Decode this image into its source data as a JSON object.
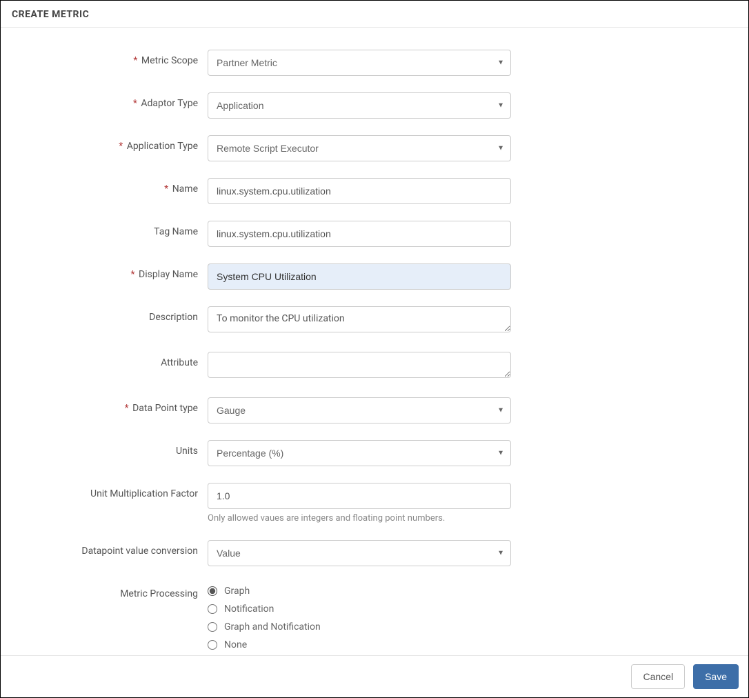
{
  "header": {
    "title": "CREATE METRIC"
  },
  "form": {
    "metric_scope": {
      "label": "Metric Scope",
      "required": true,
      "value": "Partner Metric"
    },
    "adaptor_type": {
      "label": "Adaptor Type",
      "required": true,
      "value": "Application"
    },
    "application_type": {
      "label": "Application Type",
      "required": true,
      "value": "Remote Script Executor"
    },
    "name": {
      "label": "Name",
      "required": true,
      "value": "linux.system.cpu.utilization"
    },
    "tag_name": {
      "label": "Tag Name",
      "required": false,
      "value": "linux.system.cpu.utilization"
    },
    "display_name": {
      "label": "Display Name",
      "required": true,
      "value": "System CPU Utilization"
    },
    "description": {
      "label": "Description",
      "required": false,
      "value": "To monitor the CPU utilization"
    },
    "attribute": {
      "label": "Attribute",
      "required": false,
      "value": ""
    },
    "data_point_type": {
      "label": "Data Point type",
      "required": true,
      "value": "Gauge"
    },
    "units": {
      "label": "Units",
      "required": false,
      "value": "Percentage (%)"
    },
    "unit_mult": {
      "label": "Unit Multiplication Factor",
      "required": false,
      "value": "1.0",
      "hint": "Only allowed vaues are integers and floating point numbers."
    },
    "dp_conversion": {
      "label": "Datapoint value conversion",
      "required": false,
      "value": "Value"
    },
    "metric_processing": {
      "label": "Metric Processing",
      "options": [
        "Graph",
        "Notification",
        "Graph and Notification",
        "None"
      ],
      "selected": "Graph"
    }
  },
  "footer": {
    "cancel": "Cancel",
    "save": "Save"
  }
}
